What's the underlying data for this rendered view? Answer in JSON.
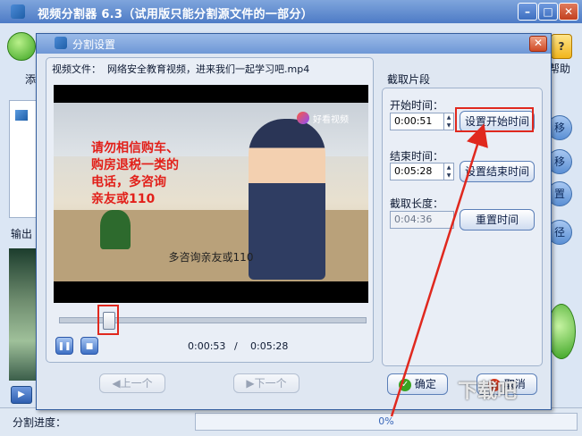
{
  "main_window": {
    "title": "视频分割器 6.3（试用版只能分割源文件的一部分）",
    "left_labels": [
      "添",
      "输出"
    ],
    "right_partial_label": "帮助",
    "side_button_labels": [
      "移",
      "移",
      "置",
      "径"
    ],
    "status_label": "分割进度：",
    "status_progress": "0%"
  },
  "dialog": {
    "title": "分割设置",
    "close_glyph": "✕",
    "video_file_label": "视频文件：",
    "video_file_name": "网络安全教育视频，进来我们一起学习吧.mp4",
    "video": {
      "overlay_text_lines": [
        "请勿相信购车、",
        "购房退税一类的",
        "电话，多咨询",
        "亲友或110"
      ],
      "subtitle": "多咨询亲友或110",
      "logo_text": "好看视频"
    },
    "playback": {
      "current_time": "0:00:53",
      "separator": "/",
      "total_time": "0:05:28",
      "progress_fraction": 0.16,
      "pause_glyph": "❚❚",
      "stop_glyph": "■"
    },
    "prev_button": "上一个",
    "next_button": "下一个",
    "clip_section": {
      "title": "截取片段",
      "start_label": "开始时间：",
      "start_value": "0:00:51",
      "set_start_button": "设置开始时间",
      "end_label": "结束时间：",
      "end_value": "0:05:28",
      "set_end_button": "设置结束时间",
      "length_label": "截取长度：",
      "length_value": "0:04:36",
      "reset_button": "重置时间"
    },
    "ok_button": "确定",
    "cancel_button": "取消"
  },
  "colors": {
    "highlight_red": "#e0281e",
    "arrow_red": "#e0281e",
    "title_blue": "#4d7bc6"
  },
  "watermark": "下载吧"
}
